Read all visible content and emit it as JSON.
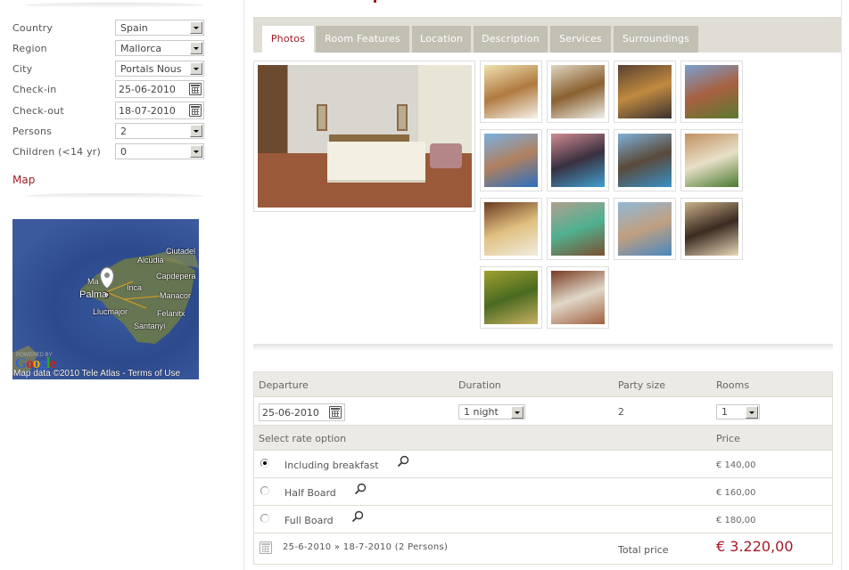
{
  "search_form": {
    "fields": [
      {
        "label": "Country",
        "type": "select",
        "value": "Spain"
      },
      {
        "label": "Region",
        "type": "select",
        "value": "Mallorca"
      },
      {
        "label": "City",
        "type": "select",
        "value": "Portals Nous"
      },
      {
        "label": "Check-in",
        "type": "date",
        "value": "25-06-2010"
      },
      {
        "label": "Check-out",
        "type": "date",
        "value": "18-07-2010"
      },
      {
        "label": "Persons",
        "type": "select",
        "value": "2"
      },
      {
        "label": "Children (<14 yr)",
        "type": "select",
        "value": "0"
      }
    ]
  },
  "map": {
    "link_label": "Map",
    "places": [
      "Ciutadel",
      "Alcúdia",
      "Capdepera",
      "Ma",
      "Inca",
      "Palma",
      "Manacor",
      "Llucmajor",
      "Felanitx",
      "Santanyí"
    ],
    "powered_by": "POWERED BY",
    "google": [
      "G",
      "o",
      "o",
      "g",
      "l",
      "e"
    ],
    "attribution": "Map data ©2010 Tele Atlas - Terms of Use"
  },
  "tabs": [
    {
      "label": "Photos",
      "active": true
    },
    {
      "label": "Room Features",
      "active": false
    },
    {
      "label": "Location",
      "active": false
    },
    {
      "label": "Description",
      "active": false
    },
    {
      "label": "Services",
      "active": false
    },
    {
      "label": "Surroundings",
      "active": false
    }
  ],
  "photos": {
    "main": "hotel-room-twin-beds",
    "thumbnails": [
      "room-armchair-flower",
      "bathroom-mirror",
      "hotel-entrance-evening",
      "hotel-garden-path",
      "pool-hotel-view",
      "pool-night-sunset",
      "pool-complex-sea",
      "terrace-garden",
      "restaurant-table",
      "indoor-pool",
      "beach-sailboats",
      "lounge-lamp",
      "atrium-palms",
      "reception-lobby"
    ]
  },
  "booking": {
    "headers": {
      "departure": "Departure",
      "duration": "Duration",
      "party_size": "Party size",
      "rooms": "Rooms"
    },
    "departure_value": "25-06-2010",
    "duration_value": "1 night",
    "party_size_value": "2",
    "rooms_value": "1",
    "rate_header": "Select rate option",
    "price_header": "Price",
    "rates": [
      {
        "label": "Including breakfast",
        "price": "€ 140,00",
        "selected": true
      },
      {
        "label": "Half Board",
        "price": "€ 160,00",
        "selected": false
      },
      {
        "label": "Full Board",
        "price": "€ 180,00",
        "selected": false
      }
    ],
    "summary": "25-6-2010 » 18-7-2010 (2 Persons)",
    "total_label": "Total price",
    "total_price": "€ 3.220,00"
  },
  "colors": {
    "accent": "#a31a25",
    "tab_bar": "#e0ddd4",
    "tab_inactive": "#c2bfb3",
    "table_header": "#eceae5"
  }
}
